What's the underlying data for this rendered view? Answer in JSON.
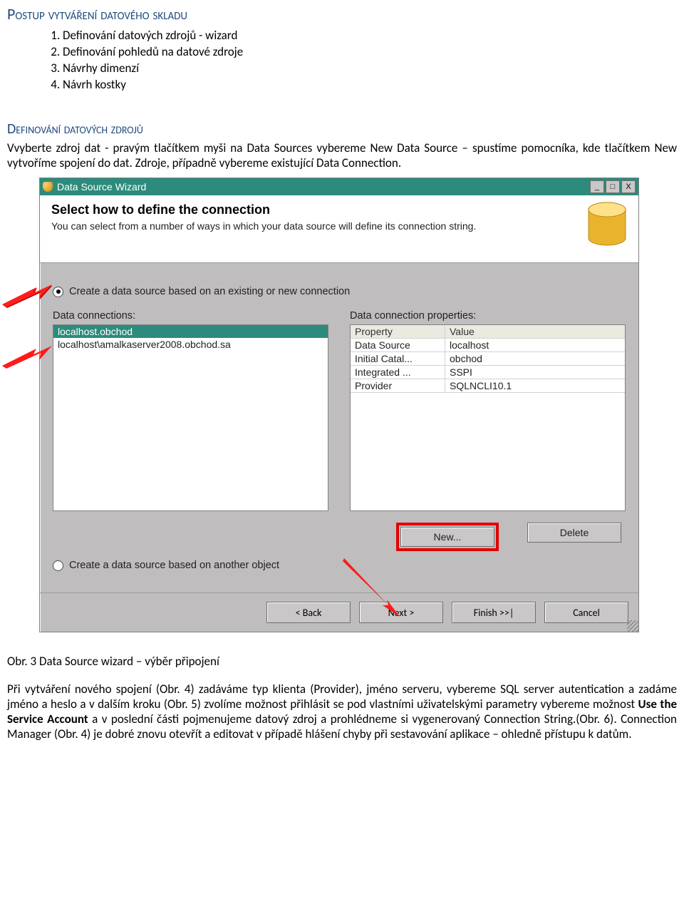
{
  "title_main": "Postup vytváření datového skladu",
  "steps": [
    "Definování datových zdrojů - wizard",
    "Definování pohledů na datové zdroje",
    "Návrhy dimenzí",
    "Návrh kostky"
  ],
  "subtitle": "Definování datových zdrojů",
  "para1": "Vvyberte zdroj dat  - pravým tlačítkem myši na Data Sources vybereme New Data Source – spustíme pomocníka, kde tlačítkem New vytvoříme spojení do dat. Zdroje, případně vybereme existující Data Connection.",
  "window": {
    "title": "Data Source Wizard",
    "header_h1": "Select how to define the connection",
    "header_h2": "You can select from a number of ways in which your data source will define its connection string.",
    "radio1": "Create a data source based on an existing or new connection",
    "radio2": "Create a data source based on another object",
    "label_left": "Data connections:",
    "label_right": "Data connection properties:",
    "list": {
      "selected": "localhost.obchod",
      "other": "localhost\\amalkaserver2008.obchod.sa"
    },
    "prop_headers": {
      "k": "Property",
      "v": "Value"
    },
    "props": [
      {
        "k": "Data Source",
        "v": "localhost"
      },
      {
        "k": "Initial Catal...",
        "v": "obchod"
      },
      {
        "k": "Integrated ...",
        "v": "SSPI"
      },
      {
        "k": "Provider",
        "v": "SQLNCLI10.1"
      }
    ],
    "btn_new": "New...",
    "btn_delete": "Delete",
    "btn_back": "< Back",
    "btn_next": "Next >",
    "btn_finish": "Finish >>|",
    "btn_cancel": "Cancel",
    "win_min": "_",
    "win_max": "□",
    "win_close": "X"
  },
  "caption": "Obr. 3 Data Source wizard – výběr připojení",
  "para2_a": "Při vytváření nového spojení (Obr. 4) zadáváme typ klienta (Provider), jméno serveru,  vybereme SQL server autentication a zadáme jméno a heslo a v dalším kroku (Obr. 5) zvolíme možnost přihlásit se pod vlastními uživatelskými parametry vybereme možnost ",
  "para2_bold": "Use the Service Account",
  "para2_b": " a v poslední části pojmenujeme datový zdroj a prohlédneme si vygenerovaný Connection String.(Obr. 6).  Connection Manager (Obr. 4) je dobré znovu otevřít a editovat v případě hlášení chyby při sestavování aplikace – ohledně přístupu k datům."
}
